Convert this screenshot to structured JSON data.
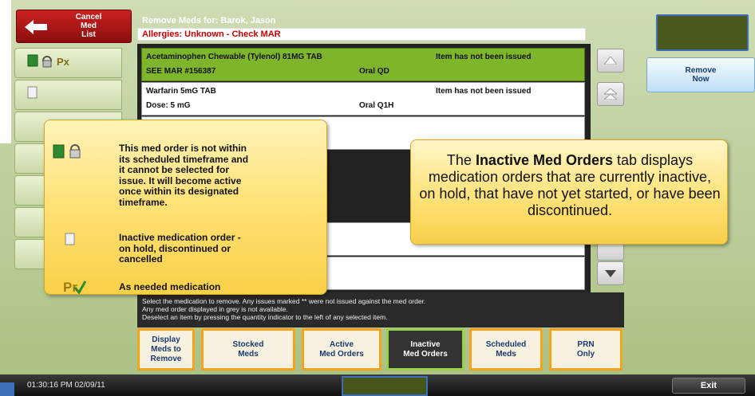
{
  "cancel": {
    "line1": "Cancel",
    "line2": "Med",
    "line3": "List"
  },
  "header": {
    "title": "Remove Meds for: Barok, Jason",
    "allergies": "Allergies: Unknown - Check MAR"
  },
  "meds": [
    {
      "name": "Acetaminophen Chewable (Tylenol) 81MG TAB",
      "status": "Item has not been issued",
      "sub": "SEE MAR #156387",
      "route": "Oral  QD"
    },
    {
      "name": "Warfarin 5mG TAB",
      "status": "Item has not been issued",
      "sub": "Dose: 5 mG",
      "route": "Oral  Q1H"
    }
  ],
  "remove_now": {
    "line1": "Remove",
    "line2": "Now"
  },
  "instructions": {
    "line1": "Select the medication to remove. Any issues marked ** were not issued against the med order.",
    "line2": "Any med order displayed in grey is not available.",
    "line3": "Deselect an item by pressing the quantity indicator to the left of any selected item."
  },
  "tabs": [
    {
      "line1": "Display",
      "line2": "Meds to",
      "line3": "Remove"
    },
    {
      "line1": "Stocked",
      "line2": "Meds",
      "line3": ""
    },
    {
      "line1": "Active",
      "line2": "Med Orders",
      "line3": ""
    },
    {
      "line1": "Inactive",
      "line2": "Med Orders",
      "line3": ""
    },
    {
      "line1": "Scheduled",
      "line2": "Meds",
      "line3": ""
    },
    {
      "line1": "PRN",
      "line2": "Only",
      "line3": ""
    }
  ],
  "legend": {
    "timeframe": [
      "This med order is not within",
      "its scheduled timeframe and",
      "it cannot be selected for",
      "issue. It will become active",
      "once within its designated",
      "timeframe."
    ],
    "inactive": [
      "Inactive medication order -",
      "on hold, discontinued or",
      "cancelled"
    ],
    "prn": "As needed medication"
  },
  "info": {
    "pre": "The ",
    "bold": "Inactive Med Orders",
    "post": " tab displays medication orders that are currently inactive, on hold, that have not yet started, or have been discontinued."
  },
  "footer": {
    "timestamp": "01:30:16 PM  02/09/11",
    "exit": "Exit"
  },
  "colors": {
    "cancel_red": "#b81c1c",
    "selected_green": "#7fb52a",
    "tab_orange": "#f7a21c",
    "callout_yellow": "#ffe27a",
    "title_blue": "#1a3a72"
  },
  "icons": [
    "left-arrow-icon",
    "green-book-icon",
    "lock-icon",
    "prn-icon",
    "blank-page-icon",
    "scroll-up-icon",
    "scroll-down-icon"
  ]
}
